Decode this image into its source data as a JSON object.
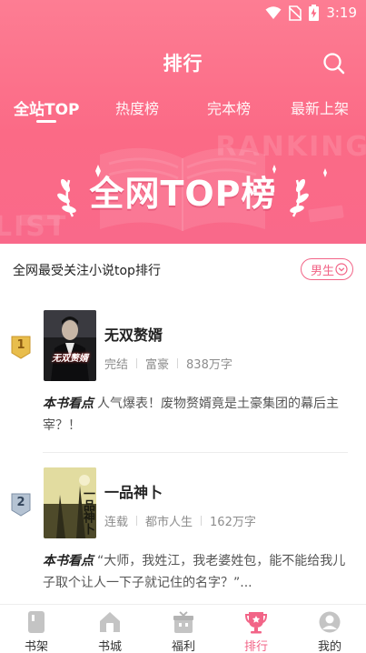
{
  "status_bar": {
    "time": "3:19"
  },
  "header": {
    "title": "排行"
  },
  "tabs": [
    {
      "label": "全站TOP",
      "active": true
    },
    {
      "label": "热度榜",
      "active": false
    },
    {
      "label": "完本榜",
      "active": false
    },
    {
      "label": "最新上架",
      "active": false
    }
  ],
  "banner": {
    "title": "全网TOP榜",
    "ghost_top": "RANKING",
    "ghost_left": "LIST"
  },
  "subheader": {
    "text": "全网最受关注小说top排行",
    "gender": "男生"
  },
  "books": [
    {
      "rank": "1",
      "title": "无双赘婿",
      "status": "完结",
      "genre": "富豪",
      "words": "838万字",
      "highlight_label": "本书看点",
      "highlight": "人气爆表！废物赘婿竟是土豪集团的幕后主宰？！",
      "cover_text": "无双赘婿"
    },
    {
      "rank": "2",
      "title": "一品神卜",
      "status": "连载",
      "genre": "都市人生",
      "words": "162万字",
      "highlight_label": "本书看点",
      "highlight": "“大师，我姓江，我老婆姓包，能不能给我儿子取个让人一下子就记住的名字？”...",
      "cover_text": "一品神卜"
    }
  ],
  "bottom_nav": [
    {
      "label": "书架",
      "icon": "bookshelf-icon",
      "active": false
    },
    {
      "label": "书城",
      "icon": "bookstore-icon",
      "active": false
    },
    {
      "label": "福利",
      "icon": "gift-icon",
      "active": false
    },
    {
      "label": "排行",
      "icon": "trophy-icon",
      "active": true
    },
    {
      "label": "我的",
      "icon": "profile-icon",
      "active": false
    }
  ],
  "colors": {
    "accent": "#f26487",
    "header_top": "#fd7d93",
    "header_bottom": "#f9698a",
    "rank1": "#e0b13c",
    "rank2": "#8fa2b7"
  }
}
